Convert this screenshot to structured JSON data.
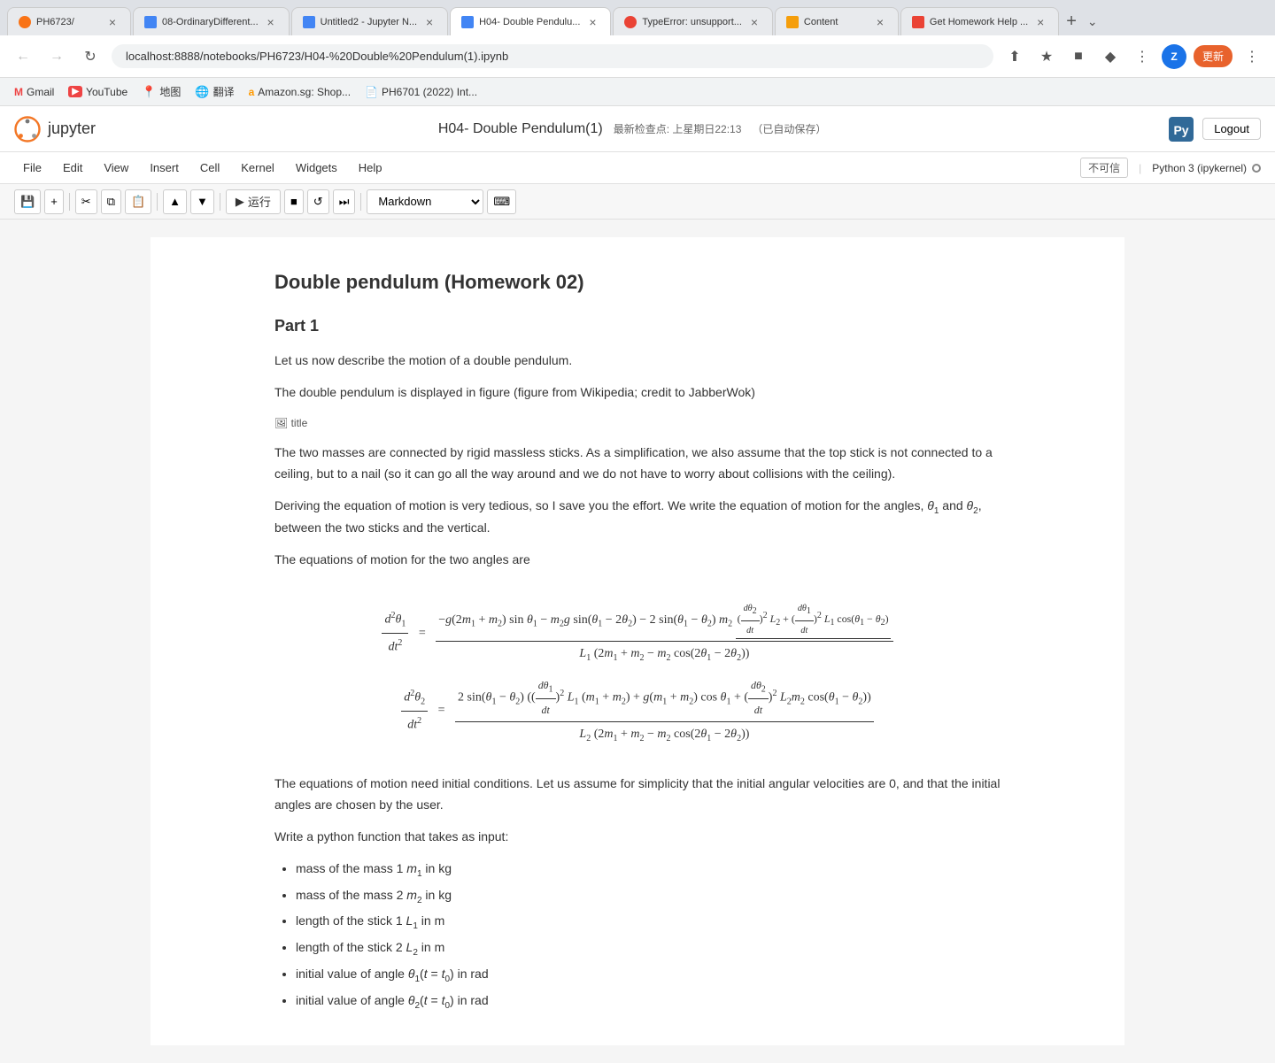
{
  "browser": {
    "tabs": [
      {
        "id": "tab1",
        "favicon_color": "#f97316",
        "title": "PH6723/",
        "active": false
      },
      {
        "id": "tab2",
        "favicon_color": "#4285f4",
        "title": "08-OrdinaryDifferent...",
        "active": false
      },
      {
        "id": "tab3",
        "favicon_color": "#4285f4",
        "title": "Untitled2 - Jupyter N...",
        "active": false
      },
      {
        "id": "tab4",
        "favicon_color": "#4285f4",
        "title": "H04- Double Pendulu...",
        "active": true
      },
      {
        "id": "tab5",
        "favicon_color": "#ea4335",
        "title": "TypeError: unsupport...",
        "active": false
      },
      {
        "id": "tab6",
        "favicon_color": "#f59e0b",
        "title": "Content",
        "active": false
      },
      {
        "id": "tab7",
        "favicon_color": "#ea4335",
        "title": "Get Homework Help ...",
        "active": false
      }
    ],
    "address": "localhost:8888/notebooks/PH6723/H04-%20Double%20Pendulum(1).ipynb",
    "new_tab_label": "+",
    "expand_label": "⌄"
  },
  "bookmarks": [
    {
      "label": "Gmail",
      "type": "text"
    },
    {
      "label": "YouTube",
      "type": "youtube"
    },
    {
      "label": "地图",
      "type": "maps"
    },
    {
      "label": "翻译",
      "type": "translate"
    },
    {
      "label": "Amazon.sg: Shop...",
      "type": "amazon"
    },
    {
      "label": "PH6701 (2022) Int...",
      "type": "doc"
    }
  ],
  "jupyter": {
    "logo_text": "jupyter",
    "notebook_title": "H04- Double Pendulum(1)",
    "checkpoint_label": "最新检查点: 上星期日22:13",
    "autosave_label": "（已自动保存）",
    "logout_label": "Logout",
    "menu": [
      "File",
      "Edit",
      "View",
      "Insert",
      "Cell",
      "Kernel",
      "Widgets",
      "Help"
    ],
    "status_label": "不可信",
    "kernel_label": "Python 3 (ipykernel)",
    "toolbar": {
      "save_icon": "💾",
      "add_icon": "+",
      "cut_icon": "✂",
      "copy_icon": "⧉",
      "paste_icon": "📋",
      "up_icon": "▲",
      "down_icon": "▼",
      "run_label": "运行",
      "stop_icon": "■",
      "restart_icon": "↺",
      "fast_forward_icon": "⏭",
      "cell_type": "Markdown",
      "keyboard_icon": "⌨"
    }
  },
  "notebook": {
    "heading": "Double pendulum (Homework 02)",
    "part1": "Part 1",
    "intro1": "Let us now describe the motion of a double pendulum.",
    "intro2": "The double pendulum is displayed in figure (figure from Wikipedia; credit to JabberWok)",
    "img_alt": "title",
    "para1": "The two masses are connected by rigid massless sticks. As a simplification, we also assume that the top stick is not connected to a ceiling, but to a nail (so it can go all the way around and we do not have to worry about collisions with the ceiling).",
    "para2": "Deriving the equation of motion is very tedious, so I save you the effort. We write the equation of motion for the angles, θ₁ and θ₂, between the two sticks and the vertical.",
    "para3": "The equations of motion for the two angles are",
    "para4": "The equations of motion need initial conditions. Let us assume for simplicity that the initial angular velocities are 0, and that the initial angles are chosen by the user.",
    "para5": "Write a python function that takes as input:",
    "list_items": [
      "mass of the mass 1 m₁ in kg",
      "mass of the mass 2 m₂ in kg",
      "length of the stick 1 L₁ in m",
      "length of the stick 2 L₂ in m",
      "initial value of angle θ₁(t = t₀) in rad",
      "initial value of angle θ₂(t = t₀) in rad"
    ]
  }
}
